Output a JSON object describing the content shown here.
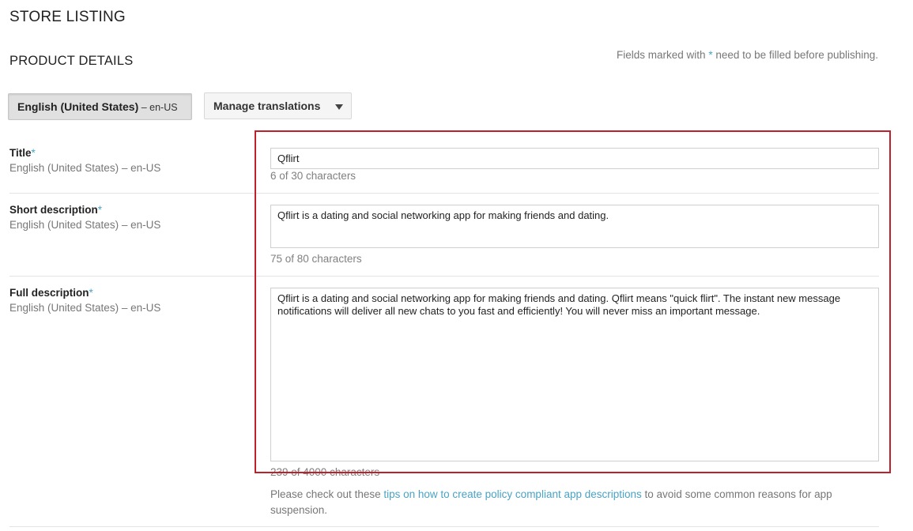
{
  "page": {
    "title": "STORE LISTING"
  },
  "section": {
    "title": "PRODUCT DETAILS",
    "required_note_prefix": "Fields marked with ",
    "required_star": "*",
    "required_note_suffix": " need to be filled before publishing."
  },
  "language_tab": {
    "name": "English (United States)",
    "code": " – en-US"
  },
  "manage_translations": {
    "label": "Manage translations",
    "icon": "caret-down-icon"
  },
  "fields": {
    "title": {
      "label": "Title",
      "star": "*",
      "sub": "English (United States) – en-US",
      "value": "Qflirt",
      "counter": "6 of 30 characters"
    },
    "short_description": {
      "label": "Short description",
      "star": "*",
      "sub": "English (United States) – en-US",
      "value": "Qflirt is a dating and social networking app for making friends and dating.",
      "counter": "75 of 80 characters"
    },
    "full_description": {
      "label": "Full description",
      "star": "*",
      "sub": "English (United States) – en-US",
      "value": "Qflirt is a dating and social networking app for making friends and dating. Qflirt means \"quick flirt\". The instant new message notifications will deliver all new chats to you fast and efficiently! You will never miss an important message.",
      "counter": "239 of 4000 characters"
    }
  },
  "policy_note": {
    "prefix": "Please check out these ",
    "link": "tips on how to create policy compliant app descriptions",
    "suffix": " to avoid some common reasons for app suspension."
  },
  "colors": {
    "accent": "#4aa3c5",
    "highlight": "#c0202a",
    "tab_bg": "#e0e0e0"
  }
}
